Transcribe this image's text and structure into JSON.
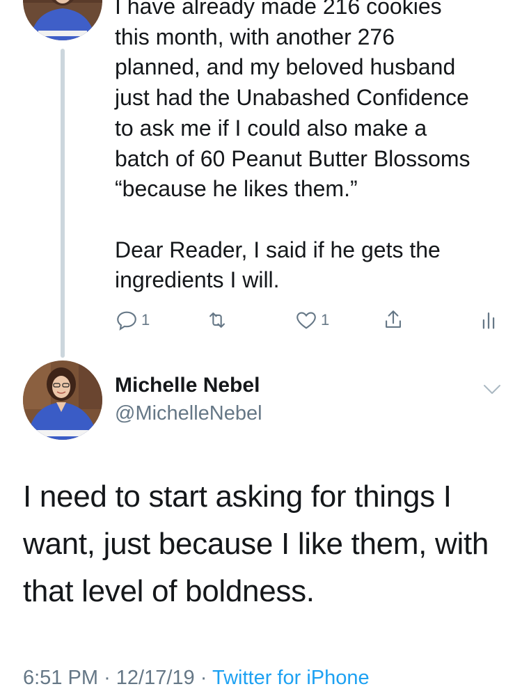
{
  "parent_tweet": {
    "text": "I have already made 216 cookies\nthis month, with another 276\nplanned, and my beloved husband\njust had the Unabashed Confidence\nto ask me if I could also make a\nbatch of 60 Peanut Butter Blossoms\n“because he likes them.”\n\nDear Reader, I said if he gets the\ningredients I will.",
    "actions": {
      "reply_icon": "reply-icon",
      "reply_count": "1",
      "retweet_icon": "retweet-icon",
      "like_icon": "heart-icon",
      "like_count": "1",
      "share_icon": "share-icon",
      "stats_icon": "analytics-icon"
    }
  },
  "main_tweet": {
    "author_name": "Michelle Nebel",
    "author_handle": "@MichelleNebel",
    "menu_icon": "chevron-down-icon",
    "text": "I need to start asking for things I want, just because I like them, with that level of boldness.",
    "time": "6:51 PM",
    "separator": "·",
    "date": "12/17/19",
    "source": "Twitter for iPhone"
  },
  "colors": {
    "text": "#14171a",
    "secondary": "#657786",
    "link": "#1da1f2",
    "thread_line": "#ccd6dd"
  }
}
